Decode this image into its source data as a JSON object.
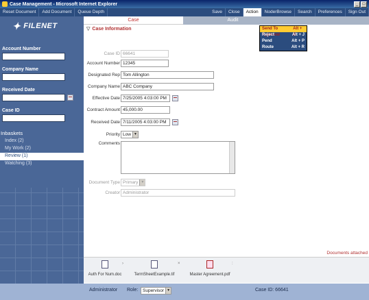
{
  "window": {
    "title": "Case Management - Microsoft Internet Explorer"
  },
  "menubar": {
    "left": [
      "Reset Document",
      "Add Document",
      "Queue Depth"
    ],
    "right": [
      "Save",
      "Close",
      "Action",
      "NoderBrowse",
      "Search",
      "Preferences",
      "Sign Out"
    ]
  },
  "action_menu": [
    {
      "label": "Send To Approval",
      "shortcut": "Alt + S"
    },
    {
      "label": "Reject",
      "shortcut": "Alt + J"
    },
    {
      "label": "Pend",
      "shortcut": "Alt + P"
    },
    {
      "label": "Route",
      "shortcut": "Alt + R"
    }
  ],
  "sidebar": {
    "logo": "FILENET",
    "account_number_label": "Account Number",
    "company_name_label": "Company Name",
    "received_date_label": "Received Date",
    "case_id_label": "Case ID",
    "inbaskets_label": "Inbaskets",
    "inbaskets": [
      "Index (2)",
      "My Work (2)",
      "Review (1)",
      "Watching (3)"
    ]
  },
  "tabs": {
    "case": "Case",
    "audit": "Audit"
  },
  "section": {
    "title": "Case Information"
  },
  "form": {
    "case_id": {
      "label": "Case ID",
      "value": "66641"
    },
    "account_number": {
      "label": "Account Number",
      "value": "12345"
    },
    "designated_rep": {
      "label": "Designated Rep",
      "value": "Tom Allington"
    },
    "company_name": {
      "label": "Company Name",
      "value": "ABC Company"
    },
    "effective_date": {
      "label": "Effective Date",
      "value": "7/25/2005 4:03:00 PM"
    },
    "contract_amount": {
      "label": "Contract Amount",
      "value": "45,000.00"
    },
    "received_date": {
      "label": "Received Date",
      "value": "7/11/2005 4:03:00 PM"
    },
    "priority": {
      "label": "Priority",
      "value": "Low"
    },
    "comments": {
      "label": "Comments",
      "value": ""
    },
    "document_type": {
      "label": "Document Type",
      "value": "Primary"
    },
    "creator": {
      "label": "Creator",
      "value": "Administrator"
    }
  },
  "attachments": {
    "message": "Documents attached",
    "items": [
      "Auth For Num.doc",
      "TermSheetExample.tif",
      "Master Agreement.pdf"
    ]
  },
  "status": {
    "user": "Administrator",
    "role_label": "Role:",
    "role_value": "Supervisor",
    "case_id": "Case ID: 66641"
  }
}
